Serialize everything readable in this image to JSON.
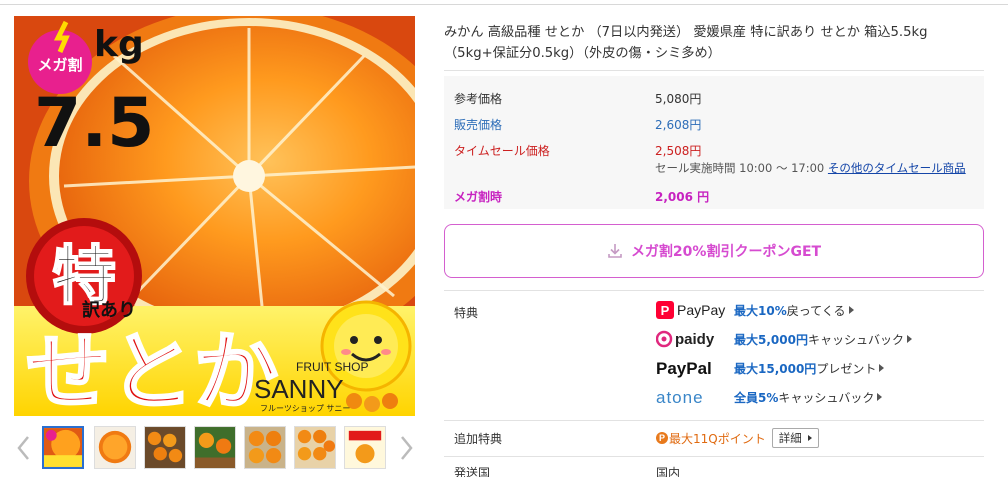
{
  "product": {
    "title": "みかん 高級品種 せとか （7日以内発送） 愛媛県産 特に訳あり せとか 箱込5.5kg （5kg+保証分0.5kg）（外皮の傷・シミ多め）",
    "image_text": {
      "badge": "メガ割",
      "weight_unit": "kg",
      "weight_value": "7.5",
      "toku": "特",
      "wakeari": "訳あり",
      "name": "せとか",
      "shop_en_top": "FRUIT SHOP",
      "shop_en": "SANNY",
      "shop_kana": "フルーツショップ サニー"
    }
  },
  "gallery": {
    "prev_arrow": "chevron-left-icon",
    "next_arrow": "chevron-right-icon",
    "thumbnail_count": 7,
    "active_index": 0
  },
  "prices": {
    "reference": {
      "label": "参考価格",
      "value": "5,080円"
    },
    "sale": {
      "label": "販売価格",
      "value": "2,608円"
    },
    "timesale": {
      "label": "タイムセール価格",
      "value": "2,508円",
      "note": "セール実施時間 10:00 ～ 17:00",
      "link": "その他のタイムセール商品"
    },
    "mega": {
      "label": "メガ割時",
      "value": "2,006 円"
    }
  },
  "coupon": {
    "label": "メガ割20%割引クーポンGET",
    "icon": "download-icon"
  },
  "perks": {
    "label": "特典",
    "items": [
      {
        "logo": "PayPay",
        "highlight": "最大10%",
        "text": "戻ってくる"
      },
      {
        "logo": "paidy",
        "highlight": "最大5,000円",
        "text": "キャッシュバック"
      },
      {
        "logo": "PayPal",
        "highlight": "最大15,000円",
        "text": "プレゼント"
      },
      {
        "logo": "atone",
        "highlight": "全員5%",
        "text": "キャッシュバック"
      }
    ]
  },
  "extra": {
    "label": "追加特典",
    "points_icon": "P",
    "points": "最大11Qポイント",
    "detail": "詳細"
  },
  "origin": {
    "label": "発送国",
    "value": "国内"
  },
  "colors": {
    "accent_pink": "#d64bd0",
    "link_blue": "#2d6db8",
    "timesale_red": "#cc2020",
    "paypay_red": "#ff0033"
  }
}
